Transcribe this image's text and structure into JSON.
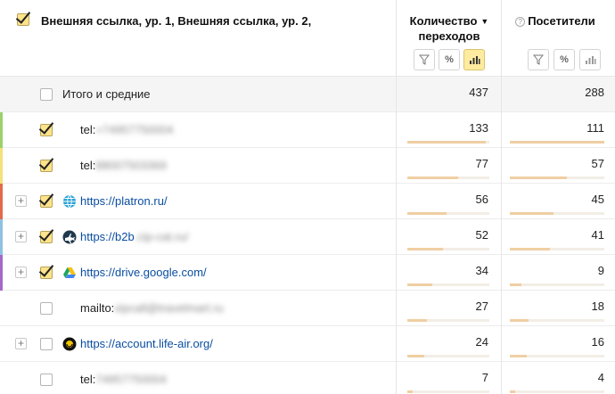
{
  "header": {
    "dimension_title": "Внешняя ссылка, ур. 1, Внешняя ссылка, ур. 2,",
    "metric1_line1": "Количество",
    "metric1_line2": "переходов",
    "metric1_sort": "▼",
    "metric2_title": "Посетители",
    "help_glyph": "?",
    "percent_glyph": "%"
  },
  "total_row": {
    "label": "Итого и средние",
    "clicks": "437",
    "visitors": "288",
    "checked": false
  },
  "rows": [
    {
      "label_prefix": "tel:",
      "label_hidden": "+74957750004",
      "clicks": "133",
      "visitors": "111",
      "checked": true,
      "expandable": false,
      "favicon": "none",
      "stripe": "#9bd16a",
      "link": false,
      "clicks_frac": 0.96,
      "visitors_frac": 1.0
    },
    {
      "label_prefix": "tel:",
      "label_hidden": "88007503369",
      "clicks": "77",
      "visitors": "57",
      "checked": true,
      "expandable": false,
      "favicon": "none",
      "stripe": "#f5e07a",
      "link": false,
      "clicks_frac": 0.62,
      "visitors_frac": 0.6
    },
    {
      "label_prefix": "https://platron.ru/",
      "label_hidden": "",
      "clicks": "56",
      "visitors": "45",
      "checked": true,
      "expandable": true,
      "favicon": "globe-icon",
      "stripe": "#e36a4a",
      "link": true,
      "clicks_frac": 0.48,
      "visitors_frac": 0.46
    },
    {
      "label_prefix": "https://b2b",
      "label_hidden": ".cip-cat.ru/",
      "clicks": "52",
      "visitors": "41",
      "checked": true,
      "expandable": true,
      "favicon": "plane-icon",
      "stripe": "#8fc1e3",
      "link": true,
      "clicks_frac": 0.43,
      "visitors_frac": 0.42
    },
    {
      "label_prefix": "https://drive.google.com/",
      "label_hidden": "",
      "clicks": "34",
      "visitors": "9",
      "checked": true,
      "expandable": true,
      "favicon": "google-drive-icon",
      "stripe": "#a568c9",
      "link": true,
      "clicks_frac": 0.3,
      "visitors_frac": 0.12
    },
    {
      "label_prefix": "mailto:",
      "label_hidden": "vipcall@travelmart.ru",
      "clicks": "27",
      "visitors": "18",
      "checked": false,
      "expandable": false,
      "favicon": "none",
      "stripe": "",
      "link": false,
      "clicks_frac": 0.24,
      "visitors_frac": 0.2
    },
    {
      "label_prefix": "https://account.life-air.org/",
      "label_hidden": "",
      "clicks": "24",
      "visitors": "16",
      "checked": false,
      "expandable": true,
      "favicon": "life-air-icon",
      "stripe": "",
      "link": true,
      "clicks_frac": 0.21,
      "visitors_frac": 0.18
    },
    {
      "label_prefix": "tel:",
      "label_hidden": "74957750004",
      "clicks": "7",
      "visitors": "4",
      "checked": false,
      "expandable": false,
      "favicon": "none",
      "stripe": "",
      "link": false,
      "clicks_frac": 0.07,
      "visitors_frac": 0.06
    }
  ],
  "colors": {
    "accent": "#ffe38a",
    "link": "#0a4ea1",
    "bar": "#f0cfa3"
  }
}
